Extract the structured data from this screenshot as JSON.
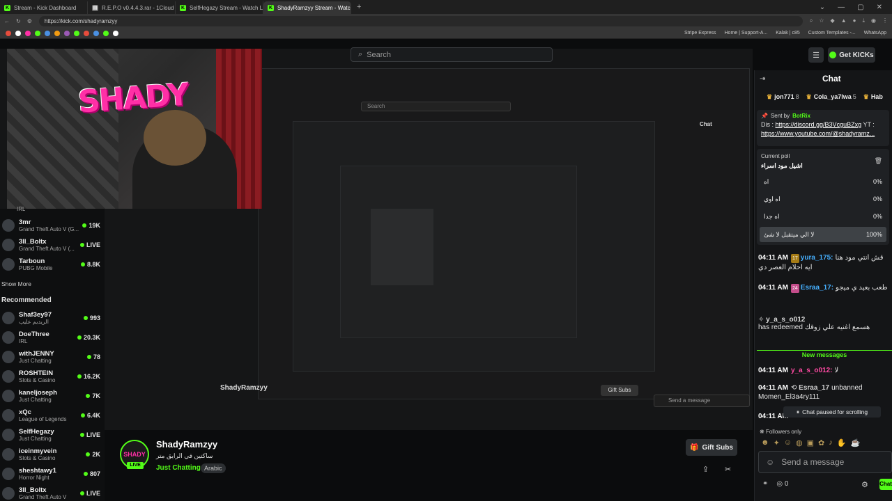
{
  "browser": {
    "tabs": [
      {
        "label": "Stream - Kick Dashboard",
        "icon": "kick-icon",
        "active": false
      },
      {
        "label": "R.E.P.O v0.4.4.3.rar - 1Cloud File",
        "icon": "file-icon",
        "active": false
      },
      {
        "label": "SelfHegazy Stream - Watch Live on K",
        "icon": "kick-icon",
        "active": false
      },
      {
        "label": "ShadyRamzyy Stream - Watch Li",
        "icon": "kick-icon",
        "active": true
      }
    ],
    "url": "https://kick.com/shadyramzyy",
    "bookmarks": [
      "Stripe Express",
      "Home | Support-A...",
      "Kalak | c85",
      "Custom Templates -...",
      "WhatsApp"
    ]
  },
  "header": {
    "search_placeholder": "Search",
    "get_kicks_label": "Get KICKs"
  },
  "video_overlay": {
    "logo_text": "SHADY",
    "inner_search": "Search",
    "inner_chat": "Chat",
    "inner_streamer": "ShadyRamzyy",
    "inner_gift": "Gift Subs",
    "inner_send": "Send a message"
  },
  "sidebar": {
    "top_cat": "IRL",
    "following": [
      {
        "name": "3mr",
        "category": "Grand Theft Auto V (G...",
        "count": "19K"
      },
      {
        "name": "3ll_Boltx",
        "category": "Grand Theft Auto V (...",
        "count": "LIVE"
      },
      {
        "name": "Tarboun",
        "category": "PUBG Mobile",
        "count": "8.8K"
      }
    ],
    "show_more": "Show More",
    "recommended_label": "Recommended",
    "recommended": [
      {
        "name": "Shaf3ey97",
        "category": "الريديم عليب",
        "count": "993"
      },
      {
        "name": "DoeThree",
        "category": "IRL",
        "count": "20.3K"
      },
      {
        "name": "withJENNY",
        "category": "Just Chatting",
        "count": "78"
      },
      {
        "name": "ROSHTEIN",
        "category": "Slots & Casino",
        "count": "16.2K"
      },
      {
        "name": "kaneljoseph",
        "category": "Just Chatting",
        "count": "7K"
      },
      {
        "name": "xQc",
        "category": "League of Legends",
        "count": "6.4K"
      },
      {
        "name": "SelfHegazy",
        "category": "Just Chatting",
        "count": "LIVE"
      },
      {
        "name": "iceinmyvein",
        "category": "Slots & Casino",
        "count": "2K"
      },
      {
        "name": "sheshtawy1",
        "category": "Horror Night",
        "count": "807"
      },
      {
        "name": "3ll_Boltx",
        "category": "Grand Theft Auto V",
        "count": "LIVE"
      }
    ]
  },
  "stream_info": {
    "streamer": "ShadyRamzyy",
    "live_label": "LIVE",
    "title": "ساكتين في الرايق متر",
    "category": "Just Chatting",
    "tag": "Arabic",
    "gift_subs_label": "Gift Subs"
  },
  "chat": {
    "title": "Chat",
    "gifters": [
      {
        "name": "jon771",
        "count": "8"
      },
      {
        "name": "Cola_ya7lwa",
        "count": "5"
      },
      {
        "name": "Hab",
        "count": ""
      }
    ],
    "pinned": {
      "sent_by": "Sent by",
      "author": "BotRix",
      "line1_prefix": "Dis :",
      "line1_link": "https://discord.gg/B3VcguBZxg",
      "line1_suffix": "YT :",
      "line2_link": "https://www.youtube.com/@shadyramz..."
    },
    "poll": {
      "label": "Current poll",
      "question": "اشيل مود اسراء",
      "options": [
        {
          "label": "اه",
          "percent": "0%",
          "share": 0
        },
        {
          "label": "اه اوي",
          "percent": "0%",
          "share": 0
        },
        {
          "label": "اه جدا",
          "percent": "0%",
          "share": 0
        },
        {
          "label": "لا الي ميتقبل لا شئ",
          "percent": "100%",
          "share": 1
        }
      ]
    },
    "messages": [
      {
        "time": "04:11 AM",
        "badge": "17",
        "user": "yura_175:",
        "text": "قش انتي مود هنا ايه احلام العصر دي",
        "color": "#46b0ff"
      },
      {
        "time": "04:11 AM",
        "badge": "24",
        "user": "Esraa_17:",
        "text": "طعب بعيد ي ميجو",
        "color": "#46b0ff"
      }
    ],
    "redeem": {
      "user": "y_a_s_o012",
      "text": "has redeemed",
      "reward": "هسمع اغنيه علي زوقك"
    },
    "new_messages_label": "New messages",
    "after_messages": [
      {
        "time": "04:11 AM",
        "user": "y_a_s_o012:",
        "text": "لا",
        "color": "#ff4aa3"
      },
      {
        "time": "04:11 AM",
        "user": "Esraa_17",
        "text": "unbanned Momen_El3a4ry111",
        "color": "#d0d0d0"
      },
      {
        "time": "04:11 AM",
        "user": "",
        "text": "",
        "color": "#d0d0d0"
      }
    ],
    "paused_label": "Chat paused for scrolling",
    "followers_only": "Followers only",
    "input_placeholder": "Send a message",
    "kicks_count": "0",
    "send_label": "Chat"
  },
  "colors": {
    "accent": "#53fc18",
    "background": "#0b0c0d",
    "brand_pink": "#ff2fa6"
  }
}
